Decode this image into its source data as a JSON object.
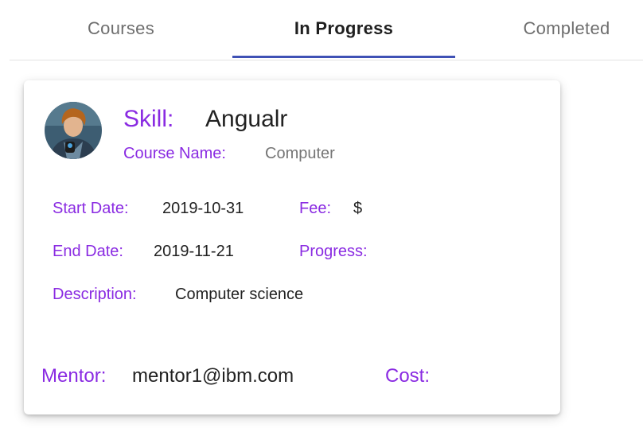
{
  "tabs": [
    {
      "label": "Courses",
      "active": false
    },
    {
      "label": "In Progress",
      "active": true
    },
    {
      "label": "Completed",
      "active": false
    }
  ],
  "colors": {
    "accent_purple": "#8a2be2",
    "ink_bar": "#3f51b5",
    "text_dark": "#222222",
    "text_grey": "#757575"
  },
  "card": {
    "avatar_icon": "user-avatar",
    "skill_label": "Skill:",
    "skill_value": "Angualr",
    "course_name_label": "Course Name:",
    "course_name_value": "Computer",
    "start_date_label": "Start Date:",
    "start_date_value": "2019-10-31",
    "fee_label": "Fee:",
    "fee_value": "$",
    "end_date_label": "End Date:",
    "end_date_value": "2019-11-21",
    "progress_label": "Progress:",
    "progress_value": "",
    "description_label": "Description:",
    "description_value": "Computer science",
    "mentor_label": "Mentor:",
    "mentor_value": "mentor1@ibm.com",
    "cost_label": "Cost:",
    "cost_value": ""
  }
}
